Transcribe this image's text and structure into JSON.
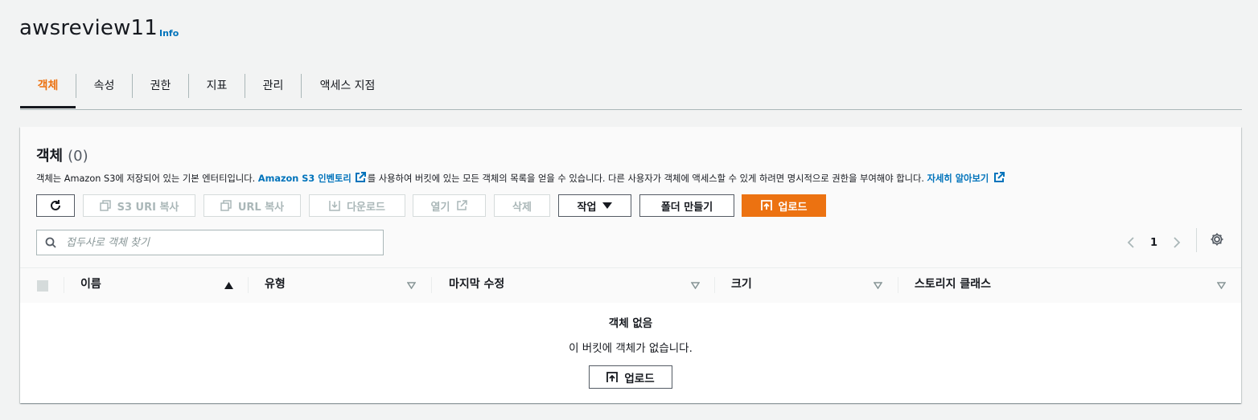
{
  "page": {
    "title": "awsreview11",
    "info_label": "Info"
  },
  "tabs": [
    {
      "label": "객체",
      "active": true
    },
    {
      "label": "속성"
    },
    {
      "label": "권한"
    },
    {
      "label": "지표"
    },
    {
      "label": "관리"
    },
    {
      "label": "액세스 지점"
    }
  ],
  "objects": {
    "title": "객체",
    "count": "(0)",
    "description_part1": "객체는 Amazon S3에 저장되어 있는 기본 엔터티입니다. ",
    "inventory_link": "Amazon S3 인벤토리",
    "description_part2": "를 사용하여 버킷에 있는 모든 객체의 목록을 얻을 수 있습니다. 다른 사용자가 객체에 액세스할 수 있게 하려면 명시적으로 권한을 부여해야 합니다. ",
    "learn_more_link": "자세히 알아보기"
  },
  "toolbar": {
    "copy_s3_uri": "S3 URI 복사",
    "copy_url": "URL 복사",
    "download": "다운로드",
    "open": "열기",
    "delete": "삭제",
    "actions": "작업",
    "create_folder": "폴더 만들기",
    "upload": "업로드"
  },
  "search": {
    "placeholder": "접두사로 객체 찾기"
  },
  "pagination": {
    "current_page": "1"
  },
  "table": {
    "columns": [
      "이름",
      "유형",
      "마지막 수정",
      "크기",
      "스토리지 클래스"
    ]
  },
  "empty_state": {
    "title": "객체 없음",
    "description": "이 버킷에 객체가 없습니다.",
    "upload_label": "업로드"
  },
  "colors": {
    "accent": "#ec7211",
    "link": "#0073bb",
    "background": "#f2f3f3"
  }
}
